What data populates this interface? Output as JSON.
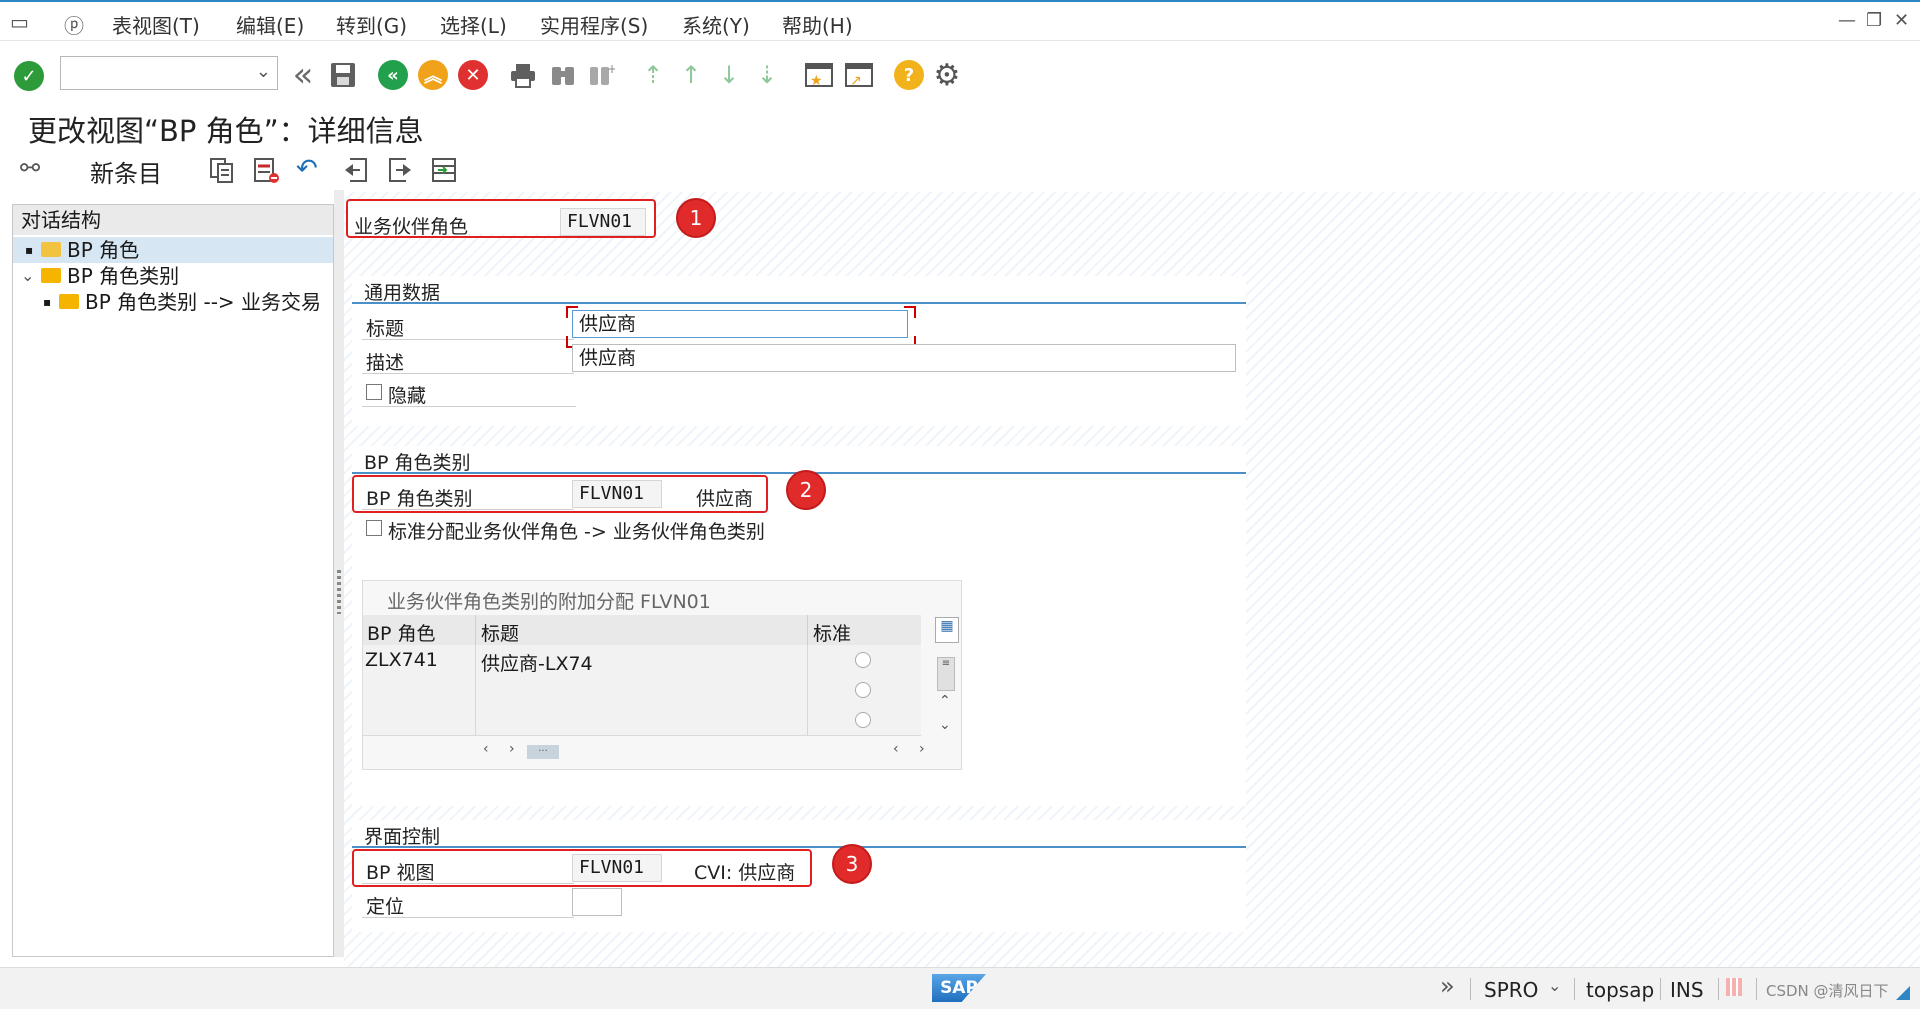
{
  "menu": {
    "items": [
      "表视图(T)",
      "编辑(E)",
      "转到(G)",
      "选择(L)",
      "实用程序(S)",
      "系统(Y)",
      "帮助(H)"
    ]
  },
  "window_controls": [
    "minimize-icon",
    "restore-icon",
    "close-icon"
  ],
  "toolbar": {
    "command_field_value": "",
    "icons": [
      "enter-icon",
      "back-nav-icon",
      "save-icon",
      "back-icon",
      "exit-icon",
      "cancel-icon",
      "print-icon",
      "find-icon",
      "find-next-icon",
      "first-page-icon",
      "previous-page-icon",
      "next-page-icon",
      "last-page-icon",
      "new-session-icon",
      "shortcut-icon",
      "help-icon",
      "settings-icon"
    ]
  },
  "title": "更改视图“BP 角色”：详细信息",
  "app_toolbar": {
    "new_entries_label": "新条目",
    "icons": [
      "display-change-icon",
      "copy-icon",
      "delete-icon",
      "undo-icon",
      "previous-entry-icon",
      "next-entry-icon",
      "select-all-icon"
    ]
  },
  "tree": {
    "header": "对话结构",
    "items": [
      {
        "label": "BP 角色",
        "level": 0,
        "selected": true
      },
      {
        "label": "BP 角色类别",
        "level": 0,
        "expanded": true
      },
      {
        "label": "BP 角色类别 --> 业务交易",
        "level": 1
      }
    ]
  },
  "role": {
    "label": "业务伙伴角色",
    "value": "FLVN01"
  },
  "general": {
    "header": "通用数据",
    "title_label": "标题",
    "title_value": "供应商",
    "desc_label": "描述",
    "desc_value": "供应商",
    "hidden_label": "隐藏",
    "hidden_checked": false
  },
  "category": {
    "header": "BP 角色类别",
    "label": "BP 角色类别",
    "value": "FLVN01",
    "text": "供应商",
    "std_label": "标准分配业务伙伴角色 -> 业务伙伴角色类别",
    "std_checked": false
  },
  "assign_table": {
    "title": "业务伙伴角色类别的附加分配 FLVN01",
    "columns": [
      "BP 角色",
      "标题",
      "标准"
    ],
    "rows": [
      [
        "ZLX741",
        "供应商-LX74",
        ""
      ],
      [
        "",
        "",
        ""
      ],
      [
        "",
        "",
        ""
      ]
    ]
  },
  "ui_control": {
    "header": "界面控制",
    "view_label": "BP 视图",
    "view_value": "FLVN01",
    "view_text": "CVI: 供应商",
    "position_label": "定位",
    "position_value": ""
  },
  "badges": [
    "1",
    "2",
    "3"
  ],
  "status": {
    "transaction": "SPRO",
    "server": "topsap",
    "mode": "INS",
    "watermark": "CSDN @清风日下"
  },
  "colors": {
    "accent": "#4a90c8",
    "annotation": "#e02020",
    "ok_green": "#2e9b3a",
    "nav_green": "#22a04b",
    "exit_orange": "#f0a21a",
    "cancel_red": "#e03131",
    "help_yellow": "#f2b21b"
  }
}
